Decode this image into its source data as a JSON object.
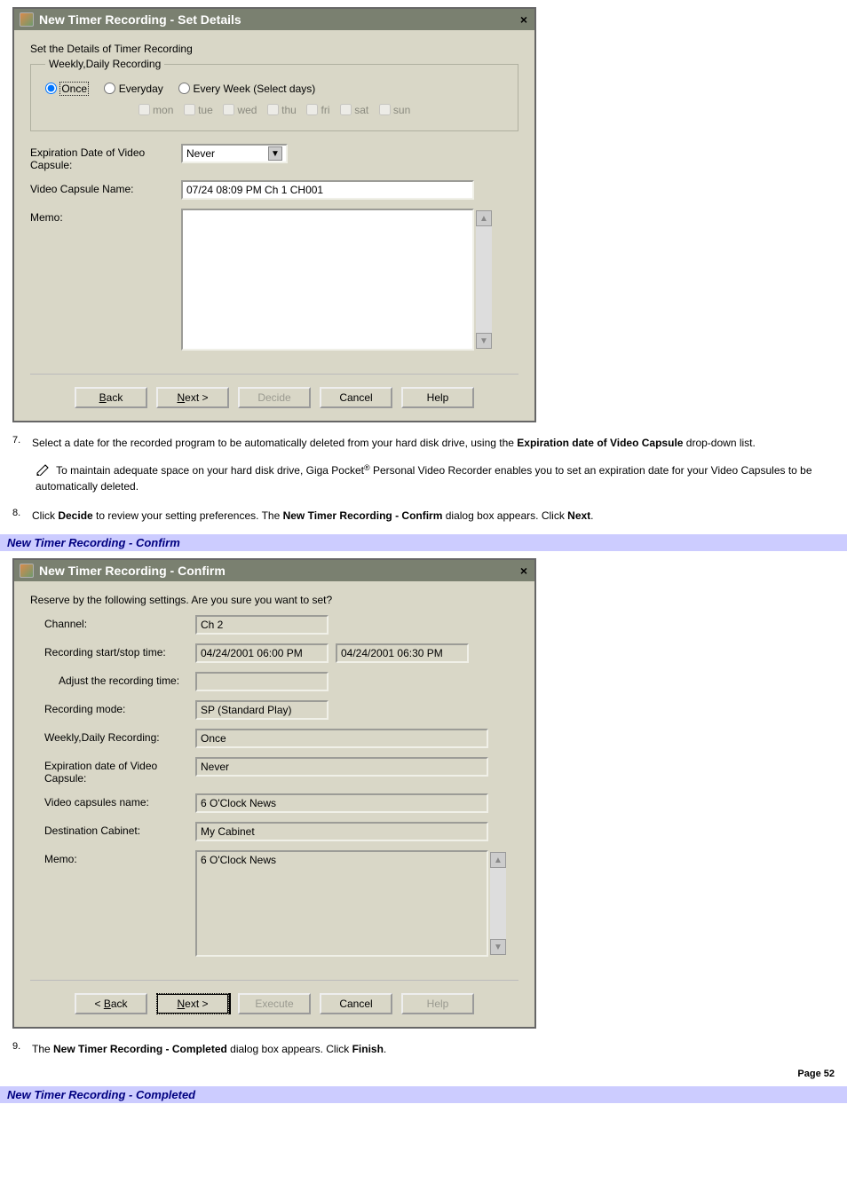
{
  "dialog1": {
    "title": "New Timer Recording - Set Details",
    "instruction": "Set the Details of Timer Recording",
    "groupLegend": "Weekly,Daily Recording",
    "radios": {
      "once": "Once",
      "everyday": "Everyday",
      "select": "Every Week (Select days)"
    },
    "days": [
      "mon",
      "tue",
      "wed",
      "thu",
      "fri",
      "sat",
      "sun"
    ],
    "expirationLabel": "Expiration Date of Video Capsule:",
    "expirationValue": "Never",
    "capsuleNameLabel": "Video Capsule Name:",
    "capsuleNameValue": "07/24 08:09 PM Ch 1 CH001",
    "memoLabel": "Memo:",
    "memoValue": "",
    "buttons": {
      "back": "< Back",
      "next": "Next >",
      "decide": "Decide",
      "cancel": "Cancel",
      "help": "Help"
    }
  },
  "step7": {
    "num": "7.",
    "text_a": "Select a date for the recorded program to be automatically deleted from your hard disk drive, using the ",
    "bold_a": "Expiration date of Video Capsule",
    "text_b": " drop-down list."
  },
  "note": {
    "text_a": " To maintain adequate space on your hard disk drive, Giga Pocket",
    "reg": "®",
    "text_b": " Personal Video Recorder enables you to set an expiration date for your Video Capsules to be automatically deleted."
  },
  "step8": {
    "num": "8.",
    "text_a": "Click ",
    "bold_a": "Decide",
    "text_b": " to review your setting preferences. The ",
    "bold_b": "New Timer Recording - Confirm",
    "text_c": " dialog box appears. Click ",
    "bold_c": "Next",
    "text_d": "."
  },
  "heading_confirm": "New Timer Recording - Confirm",
  "dialog2": {
    "title": "New Timer Recording - Confirm",
    "instruction": "Reserve by the following settings. Are you sure you want to set?",
    "labels": {
      "channel": "Channel:",
      "startstop": "Recording start/stop time:",
      "adjust": "Adjust the recording time:",
      "mode": "Recording mode:",
      "weekly": "Weekly,Daily Recording:",
      "expiration": "Expiration date of Video Capsule:",
      "capsulesname": "Video capsules name:",
      "destination": "Destination Cabinet:",
      "memo": "Memo:"
    },
    "values": {
      "channel": "Ch 2",
      "start": "04/24/2001 06:00 PM",
      "stop": "04/24/2001 06:30 PM",
      "adjust": "",
      "mode": "SP (Standard Play)",
      "weekly": "Once",
      "expiration": "Never",
      "capsulesname": "6 O'Clock News",
      "destination": "My Cabinet",
      "memo": "6 O'Clock News"
    },
    "buttons": {
      "back": "< Back",
      "next": "Next >",
      "execute": "Execute",
      "cancel": "Cancel",
      "help": "Help"
    }
  },
  "step9": {
    "num": "9.",
    "text_a": "The ",
    "bold_a": "New Timer Recording - Completed",
    "text_b": " dialog box appears. Click ",
    "bold_b": "Finish",
    "text_c": "."
  },
  "page_footer": "Page 52",
  "heading_completed": "New Timer Recording - Completed"
}
